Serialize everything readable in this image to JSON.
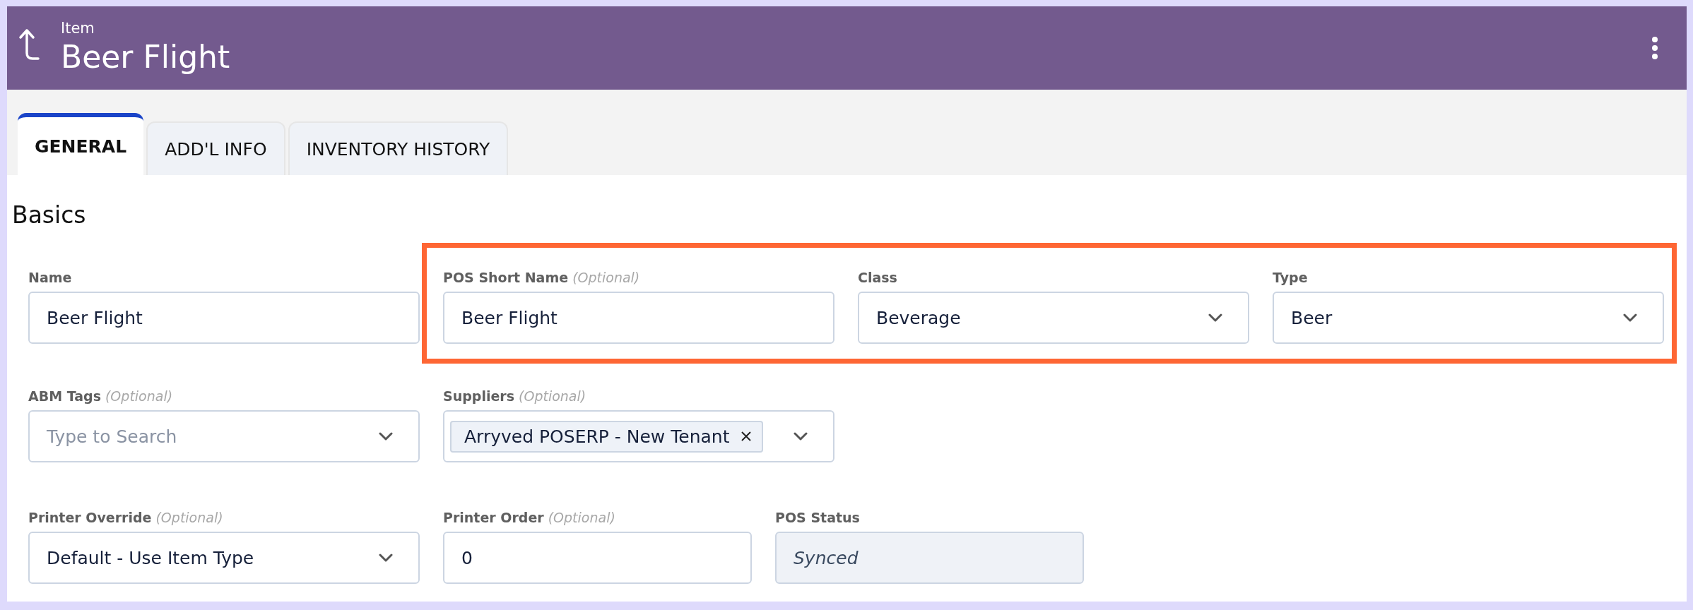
{
  "header": {
    "subtitle": "Item",
    "title": "Beer Flight"
  },
  "tabs": [
    {
      "label": "GENERAL",
      "selected": true
    },
    {
      "label": "ADD'L INFO",
      "selected": false
    },
    {
      "label": "INVENTORY HISTORY",
      "selected": false
    }
  ],
  "section_title": "Basics",
  "rows": [
    {
      "fields": [
        {
          "kind": "text",
          "label": "Name",
          "value": "Beer Flight"
        }
      ],
      "highlighted_fields": [
        {
          "kind": "text",
          "label": "POS Short Name",
          "note": "(Optional)",
          "value": "Beer Flight"
        },
        {
          "kind": "select",
          "label": "Class",
          "value": "Beverage"
        },
        {
          "kind": "select",
          "label": "Type",
          "value": "Beer"
        }
      ]
    },
    {
      "fields": [
        {
          "kind": "select",
          "label": "ABM Tags",
          "note": "(Optional)",
          "placeholder": "Type to Search"
        },
        {
          "kind": "tags",
          "label": "Suppliers",
          "note": "(Optional)",
          "tags": [
            "Arryved POSERP - New Tenant"
          ]
        }
      ]
    },
    {
      "fields": [
        {
          "kind": "select",
          "label": "Printer Override",
          "note": "(Optional)",
          "value": "Default - Use Item Type"
        },
        {
          "kind": "text",
          "label": "Printer Order",
          "note": "(Optional)",
          "value": "0"
        },
        {
          "kind": "readonly",
          "label": "POS Status",
          "value": "Synced"
        }
      ]
    }
  ]
}
